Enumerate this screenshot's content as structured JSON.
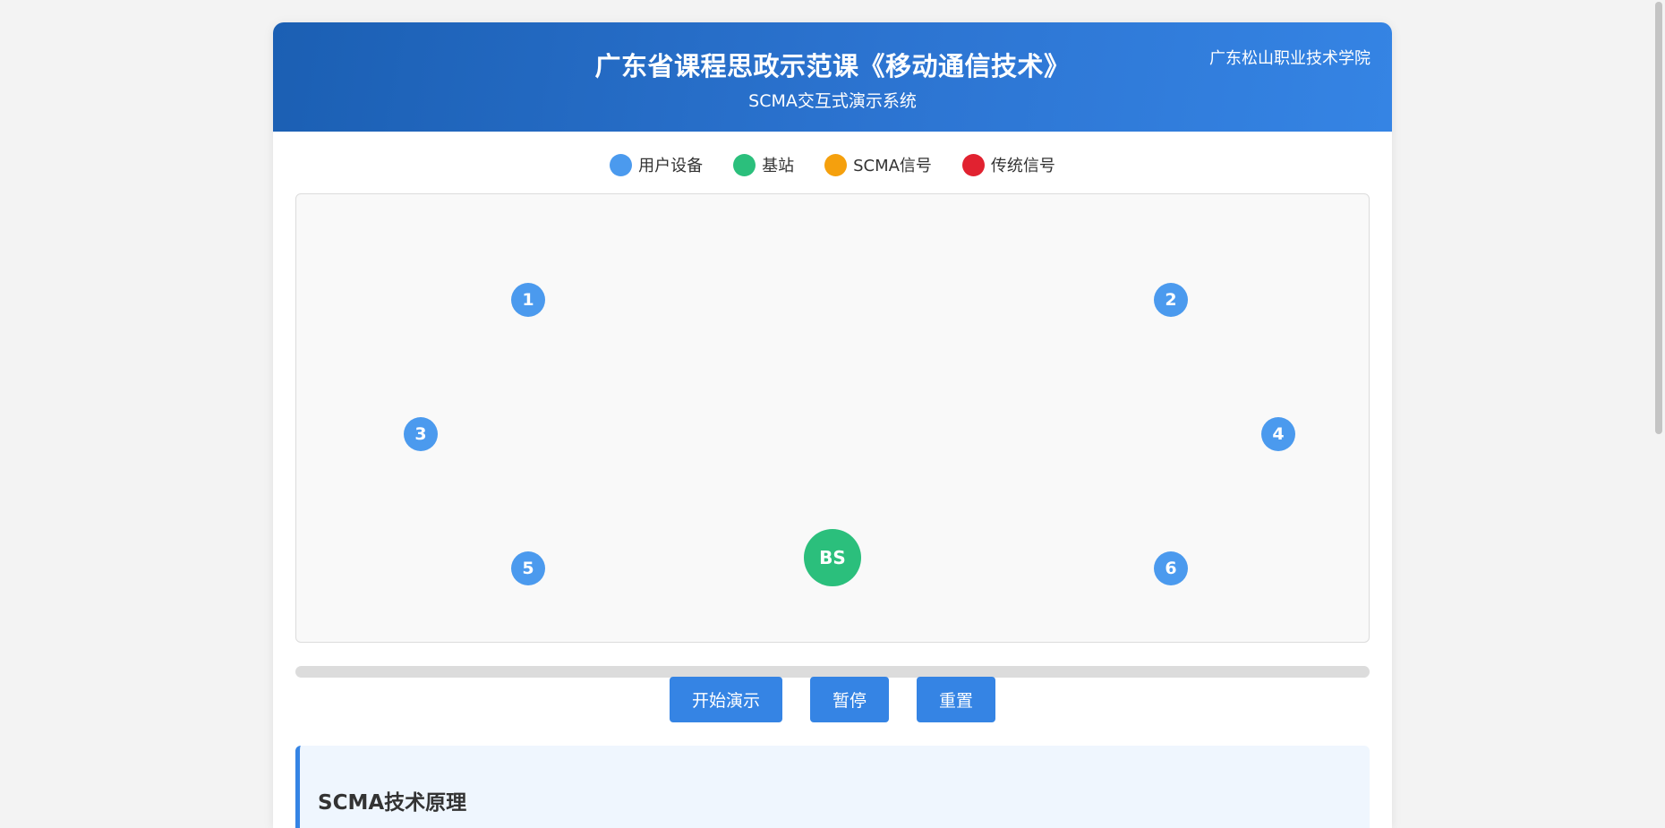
{
  "header": {
    "title": "广东省课程思政示范课《移动通信技术》",
    "subtitle": "SCMA交互式演示系统",
    "institute": "广东松山职业技术学院"
  },
  "legend": [
    {
      "label": "用户设备",
      "color": "#4b9aee"
    },
    {
      "label": "基站",
      "color": "#2bbf7c"
    },
    {
      "label": "SCMA信号",
      "color": "#f5a00d"
    },
    {
      "label": "传统信号",
      "color": "#e12230"
    }
  ],
  "canvas": {
    "users": [
      {
        "label": "1"
      },
      {
        "label": "2"
      },
      {
        "label": "3"
      },
      {
        "label": "4"
      },
      {
        "label": "5"
      },
      {
        "label": "6"
      }
    ],
    "base_station": {
      "label": "BS"
    }
  },
  "progress": {
    "value": 0
  },
  "controls": {
    "start_label": "开始演示",
    "pause_label": "暂停",
    "reset_label": "重置"
  },
  "info": {
    "title": "SCMA技术原理"
  }
}
